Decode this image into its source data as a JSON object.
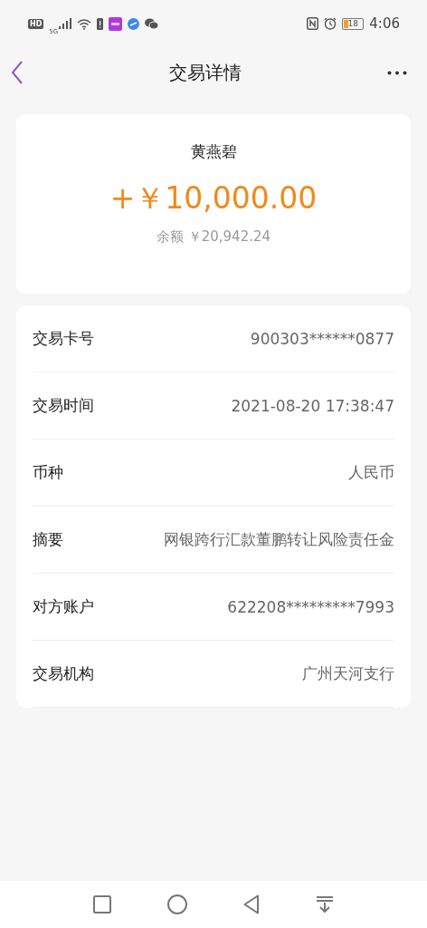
{
  "status_bar": {
    "left_labels": [
      "HD",
      "5G"
    ],
    "battery": "18",
    "time": "4:06"
  },
  "header": {
    "title": "交易详情"
  },
  "summary": {
    "name": "黄燕碧",
    "amount": "+￥10,000.00",
    "balance": "余额 ￥20,942.24"
  },
  "details": [
    {
      "label": "交易卡号",
      "value": "900303******0877"
    },
    {
      "label": "交易时间",
      "value": "2021-08-20 17:38:47"
    },
    {
      "label": "币种",
      "value": "人民币"
    },
    {
      "label": "摘要",
      "value": "网银跨行汇款董鹏转让风险责任金"
    },
    {
      "label": "对方账户",
      "value": "622208*********7993"
    },
    {
      "label": "交易机构",
      "value": "广州天河支行"
    }
  ]
}
